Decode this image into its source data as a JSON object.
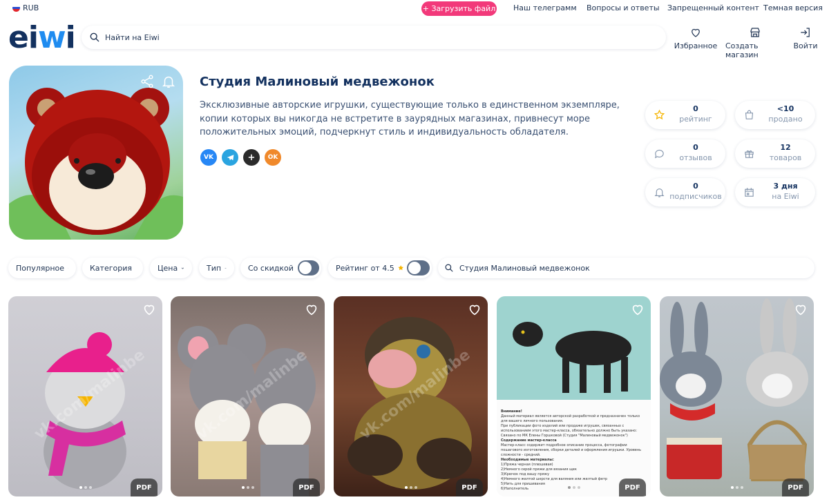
{
  "topbar": {
    "currency": "RUB",
    "upload_label": "+ Загрузить файл",
    "links": [
      "Наш телеграмм",
      "Вопросы и ответы",
      "Запрещенный контент",
      "Темная версия"
    ]
  },
  "header": {
    "logo": {
      "part1": "ei",
      "part2": "w",
      "part3": "i"
    },
    "search_placeholder": "Найти на Eiwi",
    "actions": [
      {
        "label": "Избранное",
        "icon": "heart-icon"
      },
      {
        "label": "Создать магазин",
        "icon": "shop-icon"
      },
      {
        "label": "Войти",
        "icon": "login-icon"
      }
    ]
  },
  "shop": {
    "name": "Студия Малиновый медвежонок",
    "description": "Эксклюзивные авторские игрушки, существующие только в единственном экземпляре, копии которых вы никогда не встретите в заурядных магазинах, привнесут море положительных эмоций, подчеркнут стиль и индивидуальность обладателя.",
    "socials": [
      {
        "name": "vk-icon",
        "text": "VK",
        "color": "#2787f5"
      },
      {
        "name": "telegram-icon",
        "text": "",
        "color": "#2aa4e0"
      },
      {
        "name": "plus-app-icon",
        "text": "+",
        "color": "#2b2b2b"
      },
      {
        "name": "odnoklassniki-icon",
        "text": "OK",
        "color": "#f0892b"
      }
    ],
    "stats": [
      {
        "value": "0",
        "label": "рейтинг",
        "icon": "star-icon"
      },
      {
        "value": "<10",
        "label": "продано",
        "icon": "bag-icon"
      },
      {
        "value": "0",
        "label": "отзывов",
        "icon": "comment-icon"
      },
      {
        "value": "12",
        "label": "товаров",
        "icon": "gift-icon"
      },
      {
        "value": "0",
        "label": "подписчиков",
        "icon": "bell-icon"
      },
      {
        "value": "3 дня",
        "label": "на Eiwi",
        "icon": "calendar-icon"
      }
    ]
  },
  "filters": {
    "popular": "Популярное",
    "category": "Категория",
    "price": "Цена",
    "type": "Тип",
    "discount": "Со скидкой",
    "rating": "Рейтинг от 4.5",
    "search_value": "Студия Малиновый медвежонок"
  },
  "products": [
    {
      "badge": "PDF",
      "watermark": "vk.com/malinbe"
    },
    {
      "badge": "PDF",
      "watermark": "vk.com/malinbe"
    },
    {
      "badge": "PDF",
      "watermark": "vk.com/malinbe"
    },
    {
      "badge": "PDF",
      "watermark": ""
    },
    {
      "badge": "PDF",
      "watermark": ""
    }
  ],
  "doc_preview": {
    "heading": "Внимание!",
    "lines": [
      "Данный материал является авторской разработкой и предназначен только для вашего личного пользования.",
      "При публикации фото изделий или продаже игрушек, связанных с использованием этого мастер-класса, обязательно должно быть указано: Связано по МК Елены Горшковой (Студия \"Малиновый медвежонок\")",
      "Содержание мастер-класса",
      "Мастер-класс содержит подробное описание процесса, фотографии пошагового изготовления, сборки деталей и оформления игрушки. Уровень сложности - средний.",
      "Необходимые материалы:",
      "1)Пряжа черная (плюшевая)",
      "2)Немного серой пряжи для вязания щек",
      "3)Крючок под вашу пряжу",
      "4)Немного желтой шерсти для валяния или желтый фетр",
      "5)Нить для пришивания",
      "6)Наполнитель"
    ]
  },
  "colors": {
    "accent": "#f2397a",
    "brand_dark": "#13315f",
    "brand_blue": "#1f8cf0",
    "star": "#f5b400"
  }
}
